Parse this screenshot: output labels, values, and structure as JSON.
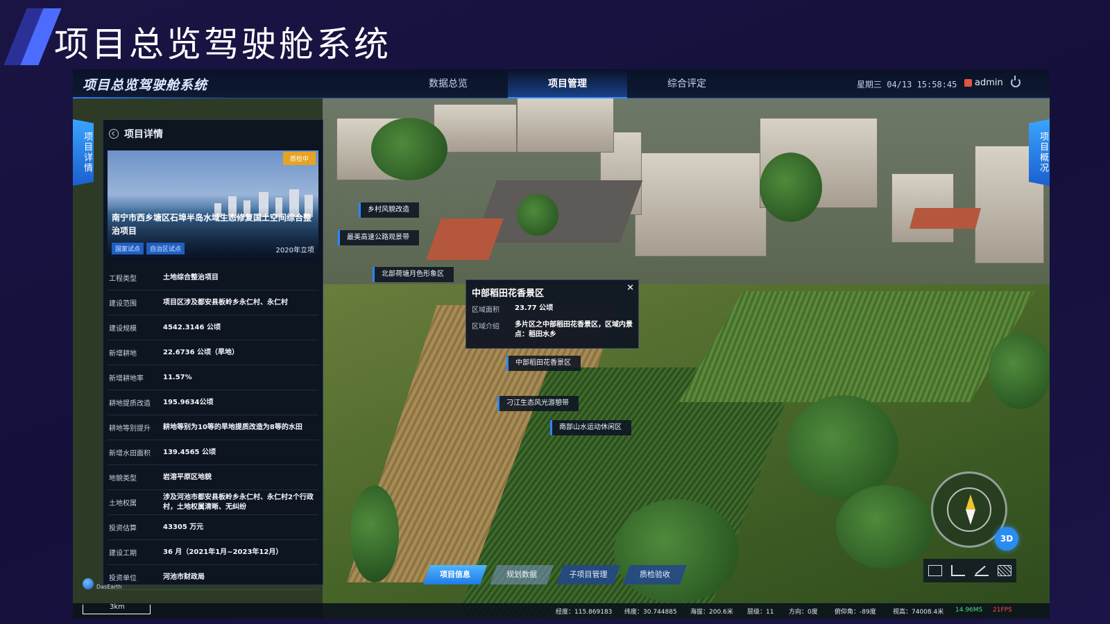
{
  "page_title": "项目总览驾驶舱系统",
  "app": {
    "brand": "项目总览驾驶舱系统",
    "nav": [
      {
        "label": "数据总览",
        "active": false
      },
      {
        "label": "项目管理",
        "active": true
      },
      {
        "label": "综合评定",
        "active": false
      }
    ],
    "datetime": "星期三 04/13 15:58:45",
    "user": "admin"
  },
  "side_tabs": {
    "left": "项目详情",
    "right": "项目概况"
  },
  "panel": {
    "title": "项目详情",
    "hero": {
      "status": "质检中",
      "name": "南宁市西乡塘区石埠半岛水域生态修复国土空间综合整治项目",
      "tags": [
        "国家试点",
        "自治区试点"
      ],
      "year": "2020年立项"
    },
    "rows": [
      {
        "label": "工程类型",
        "value": "土地综合整治项目"
      },
      {
        "label": "建设范围",
        "value": "项目区涉及都安县板岭乡永仁村、永仁村"
      },
      {
        "label": "建设规模",
        "value": "4542.3146 公顷"
      },
      {
        "label": "新增耕地",
        "value": "22.6736 公顷（旱地）"
      },
      {
        "label": "新增耕地率",
        "value": "11.57%"
      },
      {
        "label": "耕地提质改造",
        "value": "195.9634公顷"
      },
      {
        "label": "耕地等别提升",
        "value": "耕地等别为10等的旱地提质改造为8等的水田"
      },
      {
        "label": "新增水田面积",
        "value": "139.4565 公顷"
      },
      {
        "label": "地貌类型",
        "value": "岩溶平原区地貌"
      },
      {
        "label": "土地权属",
        "value": "涉及河池市都安县板岭乡永仁村、永仁村2个行政村，土地权属清晰、无纠纷"
      },
      {
        "label": "投资估算",
        "value": "43305 万元"
      },
      {
        "label": "建设工期",
        "value": "36 月（2021年1月~2023年12月）"
      },
      {
        "label": "投资单位",
        "value": "河池市财政局"
      }
    ]
  },
  "markers": [
    "乡村风貌改造",
    "最美高速公路观景带",
    "北部荷塘月色形象区",
    "中部稻田花香景区",
    "刁江生态风光游憩带",
    "南部山水运动休闲区"
  ],
  "popup": {
    "title": "中部稻田花香景区",
    "close": "✕",
    "area_label": "区域面积",
    "area_value": "23.77 公顷",
    "intro_label": "区域介绍",
    "intro_value": "多片区之中部稻田花香景区，区域内景点：稻田水乡"
  },
  "bottom_tabs": [
    {
      "label": "项目信息",
      "state": "active"
    },
    {
      "label": "规划数据",
      "state": "muted"
    },
    {
      "label": "子项目管理",
      "state": "normal"
    },
    {
      "label": "质检验收",
      "state": "normal"
    }
  ],
  "map_controls": {
    "mode_3d": "3D"
  },
  "logo": "DasEarth",
  "statusbar": {
    "scale": "3km",
    "lon": "经度：115.869183",
    "lat": "纬度：30.744885",
    "alt": "海拔：200.6米",
    "level": "层级：11",
    "heading": "方向：0度",
    "pitch": "俯仰角：-89度",
    "height": "视高：74008.4米",
    "ms": "14.96MS",
    "fps": "21FPS"
  },
  "colors": {
    "accent": "#2f86ff",
    "status_orange": "#e6a421",
    "ms_green": "#4ee07a",
    "fps_red": "#ff4a4a"
  }
}
